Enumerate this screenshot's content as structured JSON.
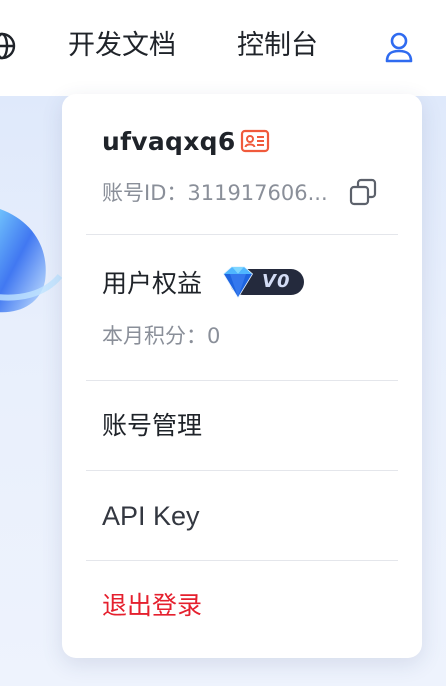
{
  "header": {
    "globe_icon": "globe-icon",
    "docs_label": "开发文档",
    "console_label": "控制台",
    "user_icon": "user-icon"
  },
  "dropdown": {
    "username": "ufvaqxq6",
    "id_badge_icon": "id-card-icon",
    "account_id": "账号ID：311917606...",
    "copy_icon": "copy-icon",
    "benefits_label": "用户权益",
    "vip_level": "V0",
    "monthly_points": "本月积分：0",
    "menu": {
      "account_management": "账号管理",
      "api_key": "API Key",
      "logout": "退出登录"
    }
  },
  "colors": {
    "accent": "#2f6bf0",
    "logout": "#e5202e",
    "id_badge": "#f05a3c",
    "text_primary": "#1f2329",
    "text_secondary": "#8a8f99"
  }
}
